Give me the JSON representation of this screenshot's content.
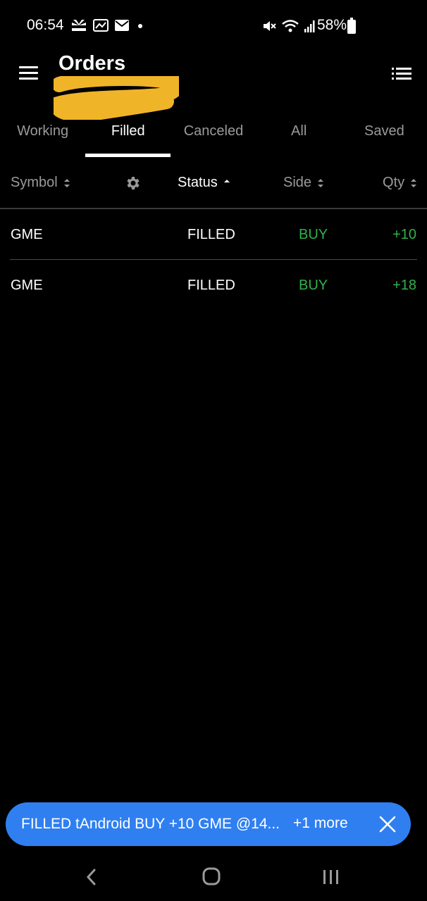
{
  "status_bar": {
    "time": "06:54",
    "battery": "58%",
    "left_icons": [
      "cnbc-icon",
      "image-mail-icon",
      "mail-icon",
      "dot-icon"
    ],
    "right_icons": [
      "mute-icon",
      "wifi-icon",
      "signal-icon",
      "battery-icon"
    ]
  },
  "header": {
    "title": "Orders"
  },
  "tabs": [
    {
      "label": "Working",
      "active": false
    },
    {
      "label": "Filled",
      "active": true
    },
    {
      "label": "Canceled",
      "active": false
    },
    {
      "label": "All",
      "active": false
    },
    {
      "label": "Saved",
      "active": false
    }
  ],
  "columns": {
    "symbol": "Symbol",
    "status": "Status",
    "side": "Side",
    "qty": "Qty"
  },
  "rows": [
    {
      "symbol": "GME",
      "status": "FILLED",
      "side": "BUY",
      "qty": "+10"
    },
    {
      "symbol": "GME",
      "status": "FILLED",
      "side": "BUY",
      "qty": "+18"
    }
  ],
  "toast": {
    "message": "FILLED tAndroid BUY +10 GME @14...",
    "more": "+1 more"
  },
  "colors": {
    "background": "#000000",
    "accent_green": "#2fb24a",
    "toast_blue": "#2f7ff0",
    "tab_inactive": "#9a9a9a",
    "scribble": "#f0b428"
  }
}
